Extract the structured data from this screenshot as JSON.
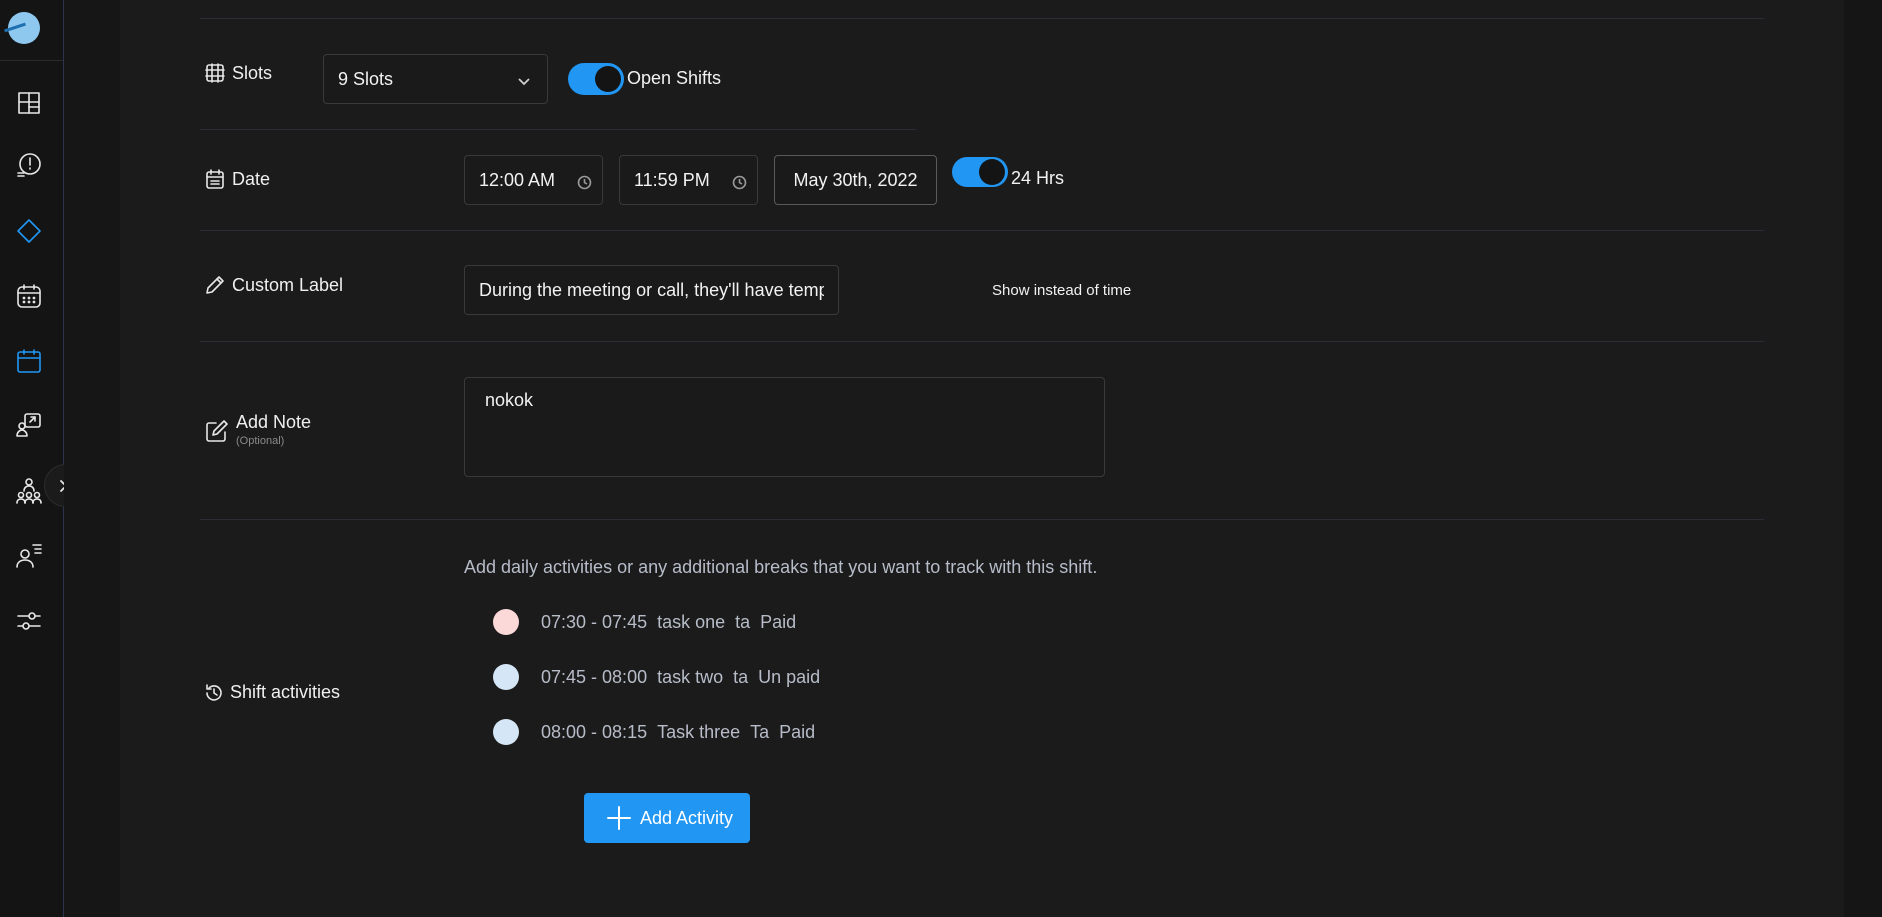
{
  "sidebar": {
    "items": [
      {
        "icon": "dashboard-icon"
      },
      {
        "icon": "alert-clock-icon"
      },
      {
        "icon": "diamond-icon",
        "active": true
      },
      {
        "icon": "calendar-grid-icon"
      },
      {
        "icon": "calendar-icon",
        "active": true
      },
      {
        "icon": "user-transfer-icon"
      },
      {
        "icon": "team-hierarchy-icon"
      },
      {
        "icon": "user-list-icon"
      },
      {
        "icon": "settings-sliders-icon"
      }
    ],
    "expand_icon": "double-chevron-right-icon"
  },
  "slots": {
    "label": "Slots",
    "selected": "9 Slots",
    "open_shifts_label": "Open Shifts",
    "open_shifts_on": true
  },
  "date": {
    "label": "Date",
    "start_time": "12:00 AM",
    "end_time": "11:59 PM",
    "date_value": "May 30th, 2022",
    "hrs24_label": "24 Hrs",
    "hrs24_on": true
  },
  "custom_label": {
    "label": "Custom Label",
    "value": "During the meeting or call, they'll have tempo",
    "show_instead_label": "Show instead of time"
  },
  "note": {
    "label": "Add Note",
    "sublabel": "(Optional)",
    "value": "nokok"
  },
  "activities": {
    "label": "Shift activities",
    "hint": "Add daily activities or any additional breaks that you want to track with this shift.",
    "items": [
      {
        "time": "07:30 - 07:45",
        "name": "task one",
        "tag": "ta",
        "pay": "Paid",
        "color": "#fcd9d9"
      },
      {
        "time": "07:45 - 08:00",
        "name": "task two",
        "tag": "ta",
        "pay": "Un paid",
        "color": "#d5e6f7"
      },
      {
        "time": "08:00 - 08:15",
        "name": "Task three",
        "tag": "Ta",
        "pay": "Paid",
        "color": "#d5e6f7"
      }
    ],
    "add_button": "Add Activity"
  },
  "colors": {
    "accent": "#2196f3",
    "background": "#1b1b1b"
  }
}
